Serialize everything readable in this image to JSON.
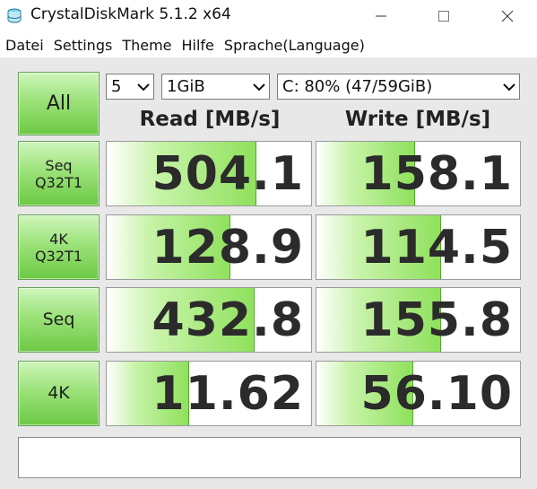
{
  "window": {
    "title": "CrystalDiskMark 5.1.2 x64"
  },
  "menu": {
    "items": [
      "Datei",
      "Settings",
      "Theme",
      "Hilfe",
      "Sprache(Language)"
    ]
  },
  "controls": {
    "all_label": "All",
    "count_value": "5",
    "size_value": "1GiB",
    "drive_value": "C: 80% (47/59GiB)"
  },
  "headers": {
    "read": "Read [MB/s]",
    "write": "Write [MB/s]"
  },
  "tests": [
    {
      "label_line1": "Seq",
      "label_line2": "Q32T1",
      "read": "504.1",
      "write": "158.1",
      "read_fill_pct": 73,
      "write_fill_pct": 48
    },
    {
      "label_line1": "4K",
      "label_line2": "Q32T1",
      "read": "128.9",
      "write": "114.5",
      "read_fill_pct": 60,
      "write_fill_pct": 61
    },
    {
      "label_line1": "Seq",
      "label_line2": "",
      "read": "432.8",
      "write": "155.8",
      "read_fill_pct": 72,
      "write_fill_pct": 61
    },
    {
      "label_line1": "4K",
      "label_line2": "",
      "read": "11.62",
      "write": "56.10",
      "read_fill_pct": 40,
      "write_fill_pct": 47
    }
  ],
  "comment": "",
  "colors": {
    "accent_green": "#8fe15d",
    "button_green": "#9ce27a",
    "background": "#e8e8e8"
  }
}
